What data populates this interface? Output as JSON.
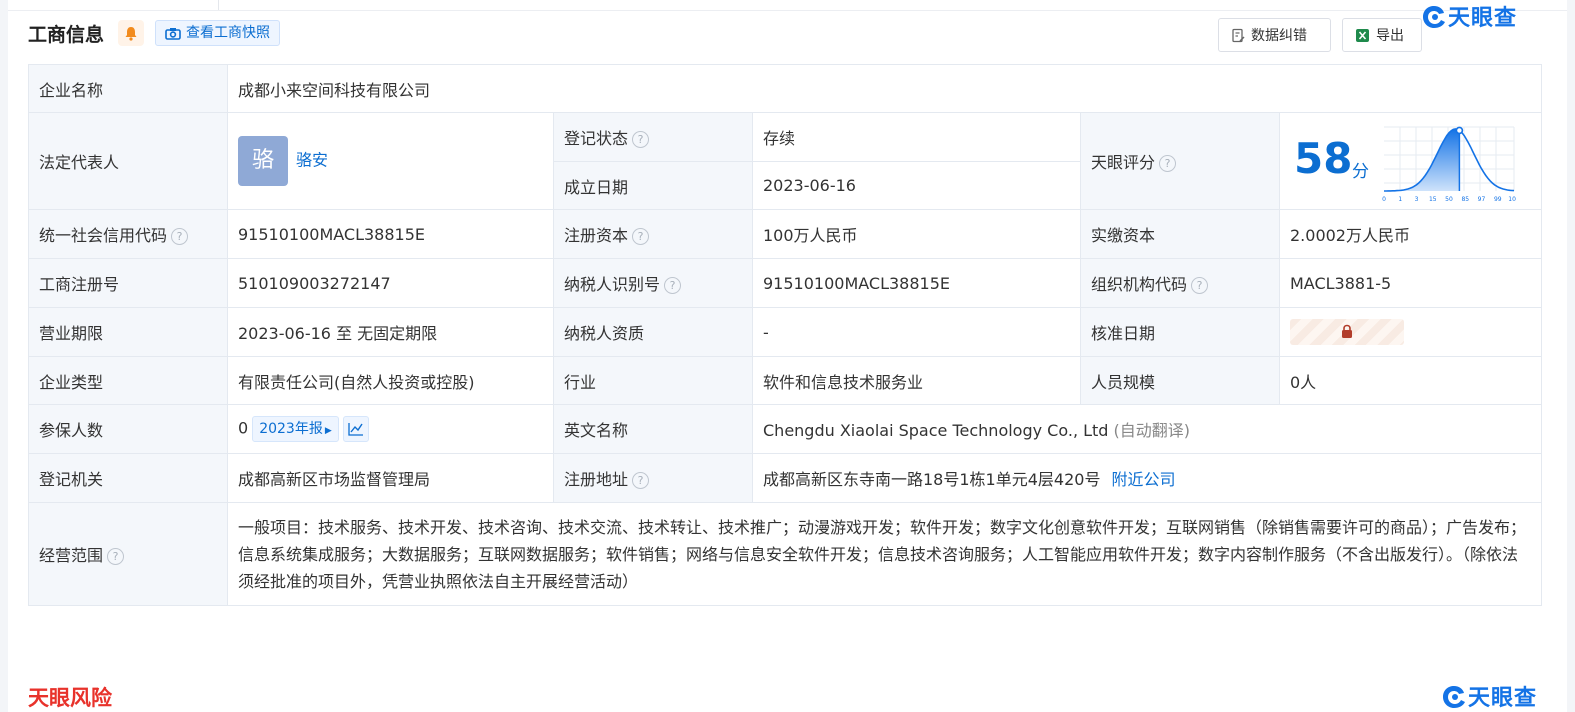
{
  "header": {
    "title": "工商信息",
    "snapshot_label": "查看工商快照",
    "correct_label": "数据纠错",
    "export_label": "导出",
    "logo_text": "天眼查"
  },
  "colors": {
    "brand": "#0c6ed1",
    "green": "#2a9a3d",
    "risk_red": "#e8322b"
  },
  "rows": {
    "company_name": {
      "k": "企业名称",
      "v": "成都小来空间科技有限公司"
    },
    "legal_rep": {
      "k": "法定代表人",
      "avatar": "骆",
      "name": "骆安"
    },
    "reg_status": {
      "k": "登记状态",
      "v": "存续"
    },
    "found_date": {
      "k": "成立日期",
      "v": "2023-06-16"
    },
    "score": {
      "k": "天眼评分",
      "value": "58",
      "unit": "分",
      "axis_labels": [
        "0",
        "1",
        "3",
        "15",
        "50",
        "85",
        "97",
        "99",
        "100"
      ],
      "position_fraction": 0.58
    },
    "credit_code": {
      "k": "统一社会信用代码",
      "v": "91510100MACL38815E"
    },
    "reg_capital": {
      "k": "注册资本",
      "v": "100万人民币"
    },
    "paid_capital": {
      "k": "实缴资本",
      "v": "2.0002万人民币"
    },
    "reg_no": {
      "k": "工商注册号",
      "v": "510109003272147"
    },
    "taxpayer_id": {
      "k": "纳税人识别号",
      "v": "91510100MACL38815E"
    },
    "org_code": {
      "k": "组织机构代码",
      "v": "MACL3881-5"
    },
    "term": {
      "k": "营业期限",
      "v": "2023-06-16 至 无固定期限"
    },
    "taxpayer_qual": {
      "k": "纳税人资质",
      "v": "-"
    },
    "approve_date": {
      "k": "核准日期"
    },
    "company_type": {
      "k": "企业类型",
      "v": "有限责任公司(自然人投资或控股)"
    },
    "industry": {
      "k": "行业",
      "v": "软件和信息技术服务业"
    },
    "staff_size": {
      "k": "人员规模",
      "v": "0人"
    },
    "insured": {
      "k": "参保人数",
      "v": "0",
      "report": "2023年报"
    },
    "english_name": {
      "k": "英文名称",
      "v": "Chengdu Xiaolai Space Technology Co., Ltd",
      "note": "(自动翻译)"
    },
    "reg_authority": {
      "k": "登记机关",
      "v": "成都高新区市场监督管理局"
    },
    "address": {
      "k": "注册地址",
      "v": "成都高新区东寺南一路18号1栋1单元4层420号",
      "link": "附近公司"
    },
    "scope": {
      "k": "经营范围",
      "v": "一般项目：技术服务、技术开发、技术咨询、技术交流、技术转让、技术推广；动漫游戏开发；软件开发；数字文化创意软件开发；互联网销售（除销售需要许可的商品）；广告发布；信息系统集成服务；大数据服务；互联网数据服务；软件销售；网络与信息安全软件开发；信息技术咨询服务；人工智能应用软件开发；数字内容制作服务（不含出版发行）。（除依法须经批准的项目外，凭营业执照依法自主开展经营活动）"
    }
  },
  "footer": {
    "risk_title": "天眼风险",
    "logo_text": "天眼查"
  }
}
